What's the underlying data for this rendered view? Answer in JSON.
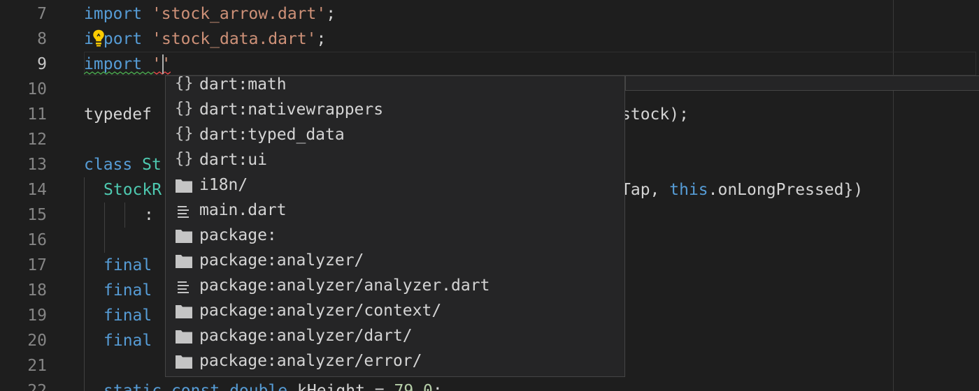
{
  "gutter": {
    "line_numbers": [
      "7",
      "8",
      "9",
      "10",
      "11",
      "12",
      "13",
      "14",
      "15",
      "16",
      "17",
      "18",
      "19",
      "20",
      "21",
      "22"
    ],
    "current_line": "9"
  },
  "code": {
    "l7": {
      "kw": "import",
      "sp": " ",
      "str": "'stock_arrow.dart'",
      "end": ";"
    },
    "l8": {
      "kw_a": "i",
      "kw_b": "port",
      "sp": " ",
      "str": "'stock_data.dart'",
      "end": ";"
    },
    "l9": {
      "kw": "import",
      "sp": " ",
      "str": "''"
    },
    "l11": {
      "kw": "typedef",
      "tail": "stock);"
    },
    "l13": {
      "kw": "class",
      "sp": " ",
      "type": "St"
    },
    "l14": {
      "type": "StockR",
      "tail_a": "Tap, ",
      "this_kw": "this",
      "tail_b": ".onLongPressed})"
    },
    "l15": {
      "text": ":"
    },
    "l17": {
      "kw": "final"
    },
    "l18": {
      "kw": "final"
    },
    "l19": {
      "kw": "final"
    },
    "l20": {
      "kw": "final"
    },
    "l22": {
      "kw1": "static",
      "kw2": "const",
      "kw3": "double",
      "name": "kHeight",
      "op": " = ",
      "num": "79.0",
      "end": ";"
    }
  },
  "suggestions": [
    {
      "kind": "module",
      "icon": "braces-icon",
      "label": "dart:math"
    },
    {
      "kind": "module",
      "icon": "braces-icon",
      "label": "dart:nativewrappers"
    },
    {
      "kind": "module",
      "icon": "braces-icon",
      "label": "dart:typed_data"
    },
    {
      "kind": "module",
      "icon": "braces-icon",
      "label": "dart:ui"
    },
    {
      "kind": "folder",
      "icon": "folder-icon",
      "label": "i18n/"
    },
    {
      "kind": "file",
      "icon": "file-icon",
      "label": "main.dart"
    },
    {
      "kind": "folder",
      "icon": "folder-icon",
      "label": "package:"
    },
    {
      "kind": "folder",
      "icon": "folder-icon",
      "label": "package:analyzer/"
    },
    {
      "kind": "file",
      "icon": "file-icon",
      "label": "package:analyzer/analyzer.dart"
    },
    {
      "kind": "folder",
      "icon": "folder-icon",
      "label": "package:analyzer/context/"
    },
    {
      "kind": "folder",
      "icon": "folder-icon",
      "label": "package:analyzer/dart/"
    },
    {
      "kind": "folder",
      "icon": "folder-icon",
      "label": "package:analyzer/error/"
    }
  ],
  "icons": {
    "brace_glyph": "{}"
  },
  "colors": {
    "background": "#1e1e1e",
    "keyword": "#569cd6",
    "string": "#ce9178",
    "type": "#4ec9b0",
    "number": "#b5cea8",
    "text": "#d4d4d4",
    "line_number": "#858585",
    "error_squiggle": "#f14c4c",
    "warning_squiggle": "#4caf50",
    "lightbulb": "#ffcc00"
  }
}
